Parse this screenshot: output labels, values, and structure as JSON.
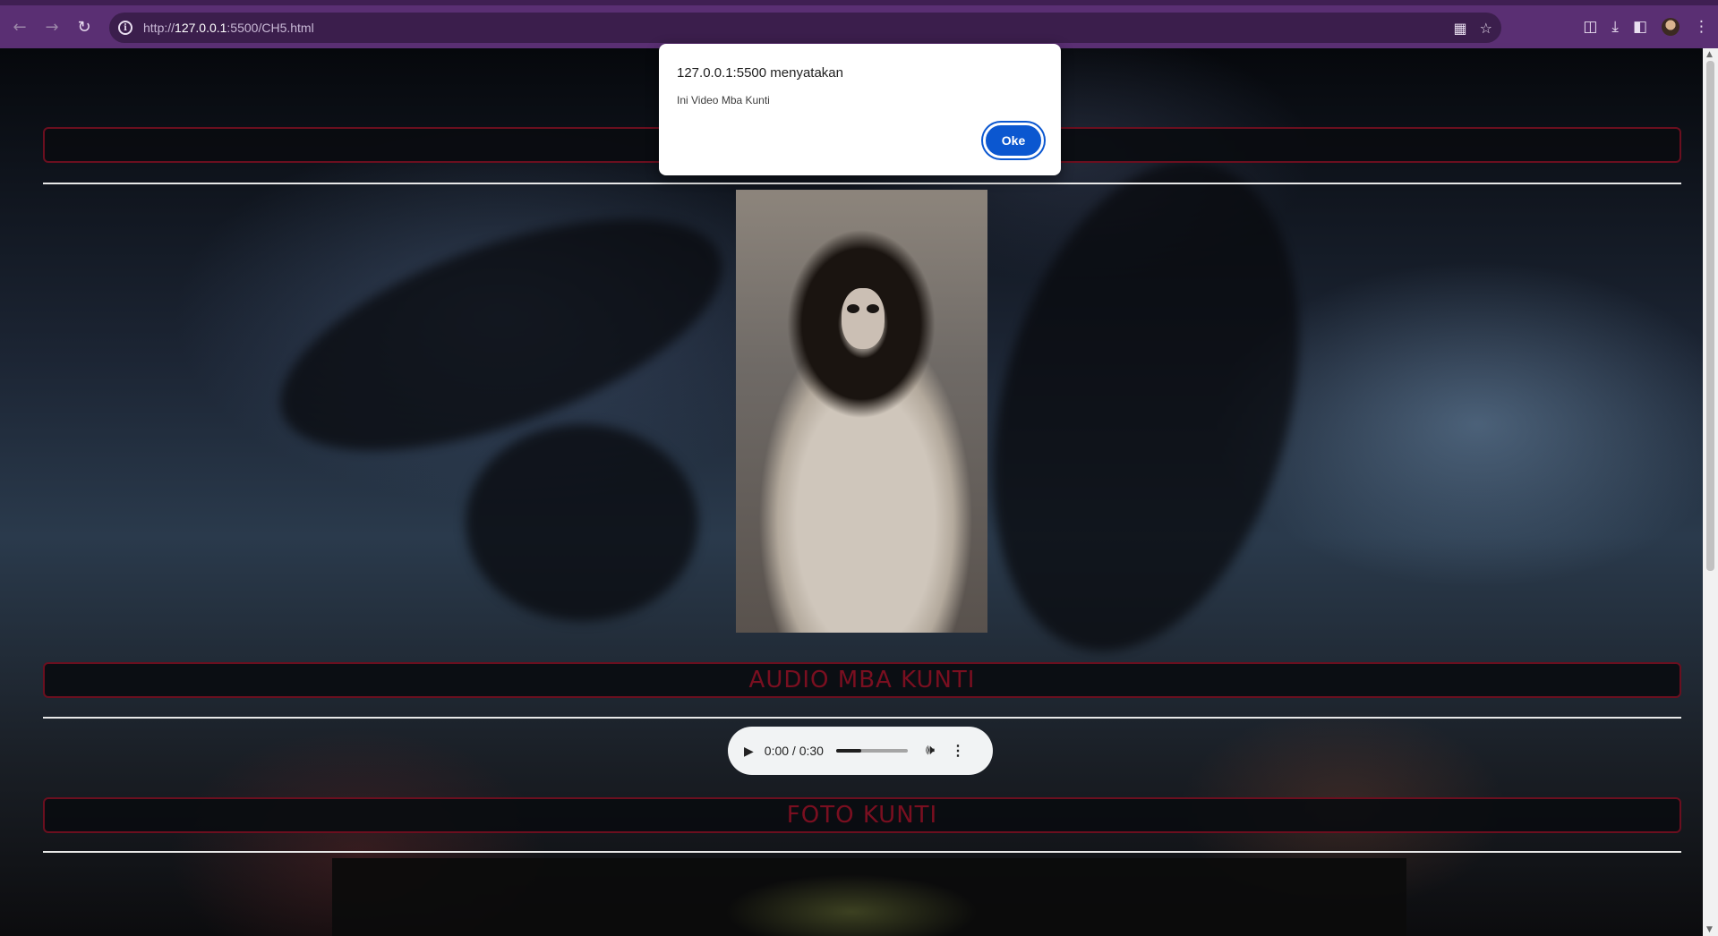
{
  "browser": {
    "url_prefix": "http://",
    "url_host": "127.0.0.1",
    "url_rest": ":5500/CH5.html"
  },
  "dialog": {
    "title": "127.0.0.1:5500 menyatakan",
    "message": "Ini Video Mba Kunti",
    "ok_label": "Oke"
  },
  "sections": {
    "video_heading": "",
    "audio_heading": "AUDIO MBA KUNTI",
    "photo_heading": "FOTO KUNTI"
  },
  "audio_player": {
    "time": "0:00 / 0:30",
    "volume_level": 0.35
  },
  "colors": {
    "chrome": "#5a2f73",
    "banner_text": "#7a0f20",
    "banner_border": "#6b0f1f",
    "dialog_button": "#0b57d0"
  },
  "icons": [
    "back-icon",
    "forward-icon",
    "reload-icon",
    "site-info-icon",
    "translate-icon",
    "star-icon",
    "extensions-icon",
    "download-icon",
    "side-panel-icon",
    "profile-avatar",
    "menu-kebab-icon",
    "play-icon",
    "volume-icon",
    "more-options-icon"
  ]
}
